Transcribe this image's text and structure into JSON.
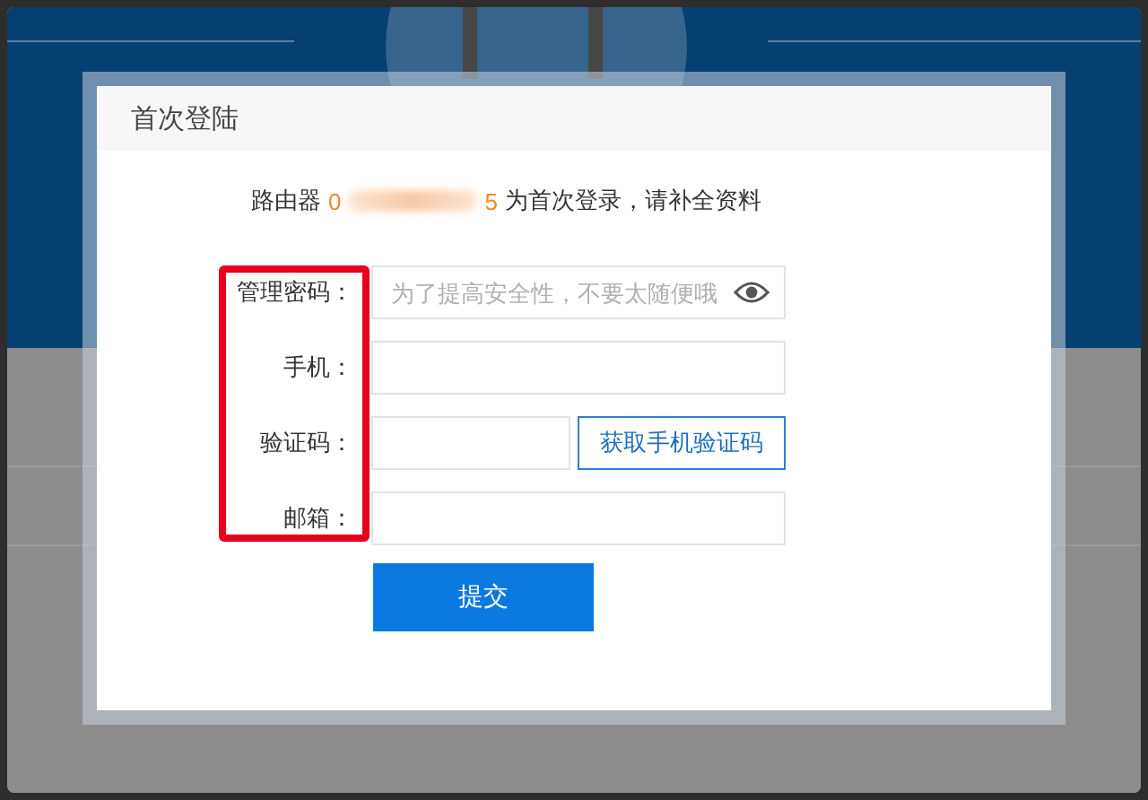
{
  "title": "首次登陆",
  "notice": {
    "prefix": "路由器",
    "id_start": "0",
    "id_end": "5",
    "suffix": "为首次登录，请补全资料"
  },
  "fields": [
    {
      "kind": "password",
      "label": "管理密码：",
      "placeholder": "为了提高安全性，不要太随便哦"
    },
    {
      "kind": "text",
      "label": "手机："
    },
    {
      "kind": "code",
      "label": "验证码：",
      "button": "获取手机验证码"
    },
    {
      "kind": "text",
      "label": "邮箱："
    }
  ],
  "submit": "提交"
}
